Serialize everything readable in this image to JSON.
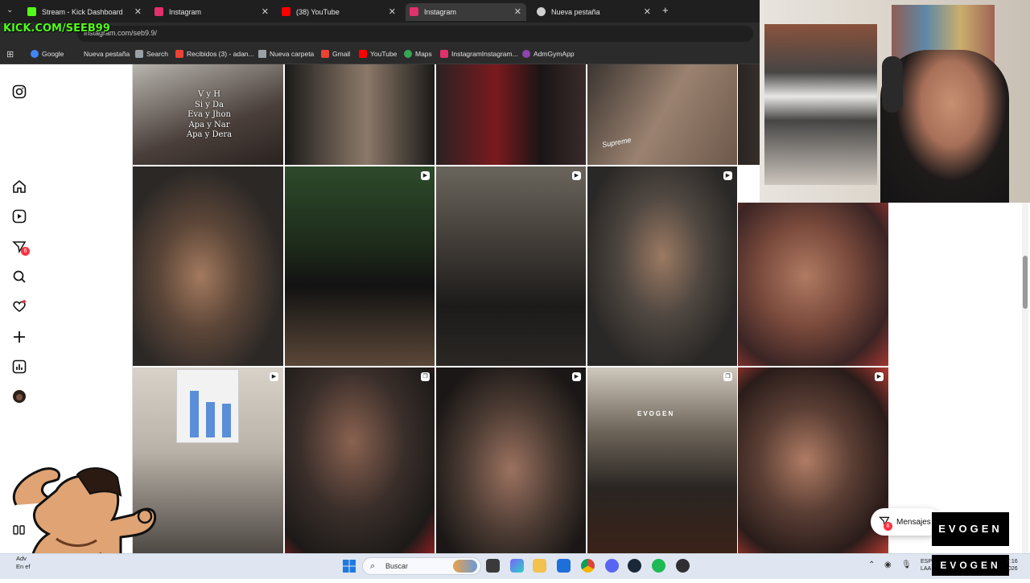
{
  "browser": {
    "tabs": [
      {
        "title": "Stream - Kick Dashboard",
        "favicon": "kick-icon",
        "color": "#53fc18"
      },
      {
        "title": "Instagram",
        "favicon": "instagram-icon",
        "color": "#e1306c"
      },
      {
        "title": "(38) YouTube",
        "favicon": "youtube-icon",
        "color": "#ff0000"
      },
      {
        "title": "Instagram",
        "favicon": "instagram-icon",
        "color": "#e1306c",
        "active": true
      },
      {
        "title": "Nueva pestaña",
        "favicon": "chrome-icon",
        "color": "#cfcfcf"
      }
    ],
    "new_tab": "+",
    "url": "instagram.com/seb9.9/",
    "kick_overlay": "KICK.COM/SEEB99",
    "bookmarks": [
      {
        "label": "Google",
        "icon": "google-icon",
        "color": "#4285f4"
      },
      {
        "label": "Nueva pestaña",
        "icon": "tab-icon",
        "color": "#9aa0a6"
      },
      {
        "label": "Search",
        "icon": "search-icon",
        "color": "#9aa0a6"
      },
      {
        "label": "Recibidos (3) - adan...",
        "icon": "gmail-icon",
        "color": "#ea4335"
      },
      {
        "label": "Nueva carpeta",
        "icon": "folder-icon",
        "color": "#9aa0a6"
      },
      {
        "label": "Gmail",
        "icon": "gmail-icon",
        "color": "#ea4335"
      },
      {
        "label": "YouTube",
        "icon": "youtube-icon",
        "color": "#ff0000"
      },
      {
        "label": "Maps",
        "icon": "maps-icon",
        "color": "#34a853"
      },
      {
        "label": "InstagramInstagram...",
        "icon": "instagram-icon",
        "color": "#e1306c"
      },
      {
        "label": "AdmGymApp",
        "icon": "app-icon",
        "color": "#8e44ad"
      }
    ]
  },
  "instagram": {
    "sidebar": [
      {
        "name": "instagram-logo-icon",
        "glyph": "◎"
      },
      {
        "name": "home-icon",
        "glyph": "⌂"
      },
      {
        "name": "reels-icon",
        "glyph": "▷"
      },
      {
        "name": "messages-icon",
        "glyph": "✉",
        "badge": "6"
      },
      {
        "name": "search-icon",
        "glyph": "⌕"
      },
      {
        "name": "notifications-icon",
        "glyph": "♡"
      },
      {
        "name": "create-icon",
        "glyph": "+"
      },
      {
        "name": "dashboard-icon",
        "glyph": "▥"
      },
      {
        "name": "profile-avatar-icon",
        "glyph": "●"
      }
    ],
    "post_text": [
      "V y H",
      "Si y Da",
      "Eva y Jhon",
      "Apa y Nar",
      "Apa y Dera"
    ],
    "top_right_caption": "Supreme",
    "shirt_text": "EVOGEN",
    "messages_label": "Mensajes",
    "messages_badge": "6",
    "tiles": [
      {
        "tone": "#8a8682",
        "reel": false
      },
      {
        "tone": "#4a4743",
        "reel": false
      },
      {
        "tone": "#3b2a2a",
        "reel": false
      },
      {
        "tone": "#6b5c50",
        "reel": false
      },
      {
        "tone": "#3c3834",
        "reel": false
      },
      {
        "tone": "#2f3a2c",
        "reel": true
      },
      {
        "tone": "#4d4740",
        "reel": true
      },
      {
        "tone": "#5a544c",
        "reel": true
      },
      {
        "tone": "#6e4a40",
        "reel": false
      },
      {
        "tone": "#b9b2a8",
        "reel": true
      },
      {
        "tone": "#413433",
        "reel": true
      },
      {
        "tone": "#2c2926",
        "reel": true
      },
      {
        "tone": "#4a3f33",
        "reel": true
      },
      {
        "tone": "#6d4a3e",
        "reel": true
      }
    ]
  },
  "branding": {
    "evogen_1": "EVOGEN",
    "evogen_2": "EVOGEN"
  },
  "taskbar": {
    "search_placeholder": "Buscar",
    "weather_line1": "Adv",
    "weather_line2": "En ef",
    "tray_line1": "ESP",
    "tray_line2": "LAA",
    "clock_line1": "7:16",
    "clock_line2": "026",
    "apps": [
      {
        "name": "windows-start-icon",
        "color": "#1f7ae0"
      },
      {
        "name": "landscape-widget-icon",
        "color": "#e8a24a"
      },
      {
        "name": "file-manager-icon",
        "color": "#3a3a3a"
      },
      {
        "name": "copilot-icon",
        "color": "#7b61ff"
      },
      {
        "name": "folder-icon",
        "color": "#f2c14e"
      },
      {
        "name": "store-icon",
        "color": "#1e6fd9"
      },
      {
        "name": "chrome-icon",
        "color": "#db4437"
      },
      {
        "name": "discord-icon",
        "color": "#5865f2"
      },
      {
        "name": "steam-icon",
        "color": "#1b2838"
      },
      {
        "name": "spotify-icon",
        "color": "#1db954"
      },
      {
        "name": "obs-icon",
        "color": "#302e31"
      }
    ]
  }
}
